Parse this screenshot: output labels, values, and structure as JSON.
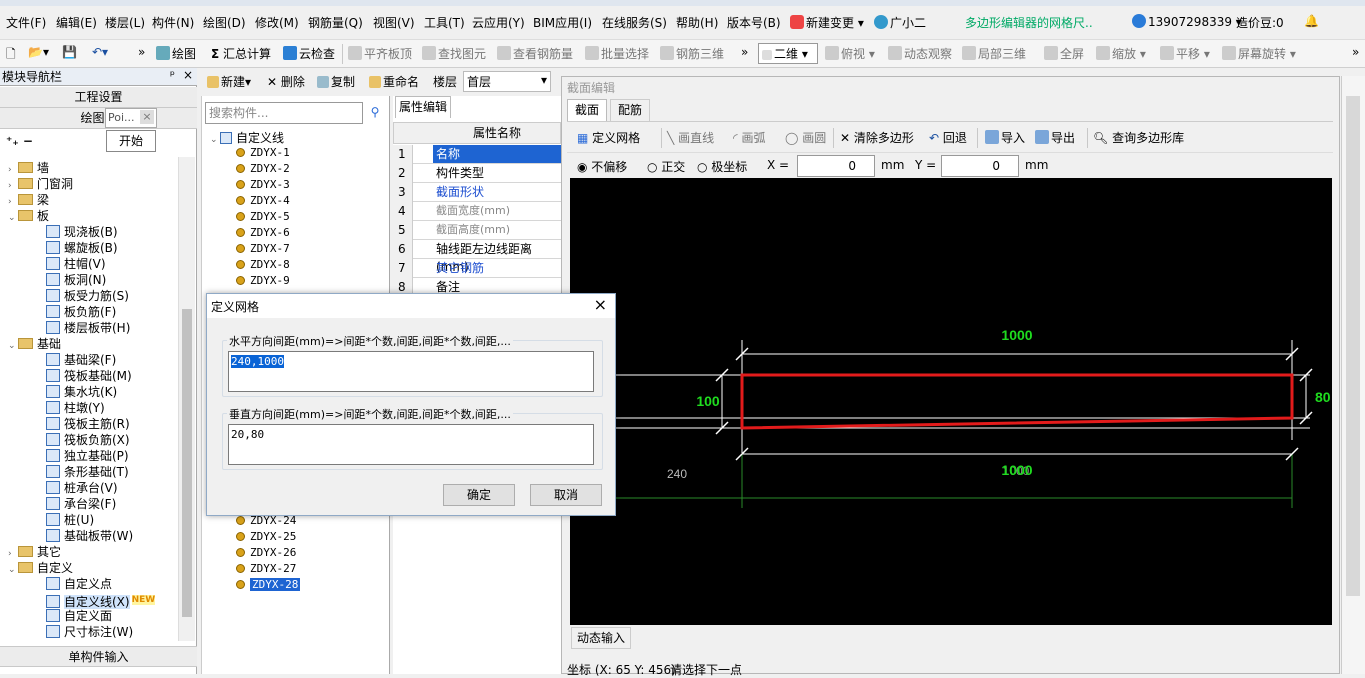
{
  "menu": {
    "items": [
      "文件(F)",
      "编辑(E)",
      "楼层(L)",
      "构件(N)",
      "绘图(D)",
      "修改(M)",
      "钢筋量(Q)",
      "视图(V)",
      "工具(T)",
      "云应用(Y)",
      "BIM应用(I)",
      "在线服务(S)",
      "帮助(H)",
      "版本号(B)"
    ],
    "new_change": "新建变更",
    "assistant": "广小二",
    "notice": "多边形编辑器的网格尺..",
    "phone": "13907298339",
    "beans": "造价豆:0"
  },
  "toolbar": {
    "draw": "绘图",
    "sum": "汇总计算",
    "cloud_check": "云检查",
    "flat_top": "平齐板顶",
    "find_elem": "查找图元",
    "view_rebar": "查看钢筋量",
    "batch_select": "批量选择",
    "rebar_3d": "钢筋三维",
    "view_mode": "二维",
    "top_view": "俯视",
    "dyn_obs": "动态观察",
    "local_3d": "局部三维",
    "fullscreen": "全屏",
    "zoom": "缩放",
    "pan": "平移",
    "rotate": "屏幕旋转"
  },
  "nav": {
    "title": "模块导航栏",
    "pin": "ᵖ",
    "close": "×",
    "project_settings": "工程设置",
    "draw_input": "绘图输",
    "popup_label": "Poi...",
    "start_btn": "开始",
    "tree": [
      {
        "label": "墙",
        "level": 0,
        "type": "folder",
        "state": "collapsed"
      },
      {
        "label": "门窗洞",
        "level": 0,
        "type": "folder",
        "state": "collapsed"
      },
      {
        "label": "梁",
        "level": 0,
        "type": "folder",
        "state": "collapsed"
      },
      {
        "label": "板",
        "level": 0,
        "type": "folder",
        "state": "expanded"
      },
      {
        "label": "现浇板(B)",
        "level": 1,
        "type": "leaf"
      },
      {
        "label": "螺旋板(B)",
        "level": 1,
        "type": "leaf"
      },
      {
        "label": "柱帽(V)",
        "level": 1,
        "type": "leaf"
      },
      {
        "label": "板洞(N)",
        "level": 1,
        "type": "leaf"
      },
      {
        "label": "板受力筋(S)",
        "level": 1,
        "type": "leaf"
      },
      {
        "label": "板负筋(F)",
        "level": 1,
        "type": "leaf"
      },
      {
        "label": "楼层板带(H)",
        "level": 1,
        "type": "leaf"
      },
      {
        "label": "基础",
        "level": 0,
        "type": "folder",
        "state": "expanded"
      },
      {
        "label": "基础梁(F)",
        "level": 1,
        "type": "leaf"
      },
      {
        "label": "筏板基础(M)",
        "level": 1,
        "type": "leaf"
      },
      {
        "label": "集水坑(K)",
        "level": 1,
        "type": "leaf"
      },
      {
        "label": "柱墩(Y)",
        "level": 1,
        "type": "leaf"
      },
      {
        "label": "筏板主筋(R)",
        "level": 1,
        "type": "leaf"
      },
      {
        "label": "筏板负筋(X)",
        "level": 1,
        "type": "leaf"
      },
      {
        "label": "独立基础(P)",
        "level": 1,
        "type": "leaf"
      },
      {
        "label": "条形基础(T)",
        "level": 1,
        "type": "leaf"
      },
      {
        "label": "桩承台(V)",
        "level": 1,
        "type": "leaf"
      },
      {
        "label": "承台梁(F)",
        "level": 1,
        "type": "leaf"
      },
      {
        "label": "桩(U)",
        "level": 1,
        "type": "leaf"
      },
      {
        "label": "基础板带(W)",
        "level": 1,
        "type": "leaf"
      },
      {
        "label": "其它",
        "level": 0,
        "type": "folder",
        "state": "collapsed"
      },
      {
        "label": "自定义",
        "level": 0,
        "type": "folder",
        "state": "expanded"
      },
      {
        "label": "自定义点",
        "level": 1,
        "type": "leaf"
      },
      {
        "label": "自定义线(X)",
        "level": 1,
        "type": "leaf",
        "selected": true,
        "badge": "NEW"
      },
      {
        "label": "自定义面",
        "level": 1,
        "type": "leaf"
      },
      {
        "label": "尺寸标注(W)",
        "level": 1,
        "type": "leaf"
      }
    ],
    "single_input": "单构件输入"
  },
  "components": {
    "toolbar": {
      "new": "新建",
      "delete": "删除",
      "copy": "复制",
      "rename": "重命名",
      "floor_label": "楼层",
      "floor": "首层"
    },
    "search_placeholder": "搜索构件...",
    "root": "自定义线",
    "items_top": [
      "ZDYX-1",
      "ZDYX-2",
      "ZDYX-3",
      "ZDYX-4",
      "ZDYX-5",
      "ZDYX-6",
      "ZDYX-7",
      "ZDYX-8",
      "ZDYX-9"
    ],
    "items_bottom": [
      "ZDYX-24",
      "ZDYX-25",
      "ZDYX-26",
      "ZDYX-27",
      "ZDYX-28"
    ],
    "selected": "ZDYX-28"
  },
  "props": {
    "tab": "属性编辑",
    "header": "属性名称",
    "rows": [
      {
        "num": "1",
        "name": "名称",
        "style": "selected"
      },
      {
        "num": "2",
        "name": "构件类型",
        "style": "normal"
      },
      {
        "num": "3",
        "name": "截面形状",
        "style": "blue"
      },
      {
        "num": "4",
        "name": "截面宽度(mm)",
        "style": "gray"
      },
      {
        "num": "5",
        "name": "截面高度(mm)",
        "style": "gray"
      },
      {
        "num": "6",
        "name": "轴线距左边线距离(mm)",
        "style": "normal"
      },
      {
        "num": "7",
        "name": "其它钢筋",
        "style": "blue"
      },
      {
        "num": "8",
        "name": "备注",
        "style": "normal"
      }
    ]
  },
  "editor": {
    "title": "截面编辑",
    "tabs": [
      "截面",
      "配筋"
    ],
    "tools": {
      "define_grid": "定义网格",
      "draw_line": "画直线",
      "draw_arc": "画弧",
      "draw_circle": "画圆",
      "clear_poly": "清除多边形",
      "undo": "回退",
      "import": "导入",
      "export": "导出",
      "query_lib": "查询多边形库"
    },
    "snap": {
      "no_offset": "不偏移",
      "ortho": "正交",
      "polar": "极坐标",
      "x_label": "X =",
      "x_value": "0",
      "y_label": "Y =",
      "y_value": "0",
      "unit": "mm"
    },
    "dims": {
      "top_width": "1000",
      "left_height": "100",
      "right_height": "80",
      "bottom_width": "1000",
      "bottom_ghost": "1000",
      "left_offset": "240"
    },
    "dynamic_input": "动态输入",
    "status_coord": "坐标 (X: 65 Y: 456)",
    "status_msg": "请选择下一点"
  },
  "dialog": {
    "title": "定义网格",
    "h_label": "水平方向间距(mm)=>间距*个数,间距,间距*个数,间距,...",
    "h_value": "240,1000",
    "v_label": "垂直方向间距(mm)=>间距*个数,间距,间距*个数,间距,...",
    "v_value": "20,80",
    "ok": "确定",
    "cancel": "取消",
    "close": "×"
  },
  "colors": {
    "accent": "#0a64d6",
    "selected": "#1e64d2",
    "red": "#e21b1b",
    "green": "#1fdc1f"
  }
}
